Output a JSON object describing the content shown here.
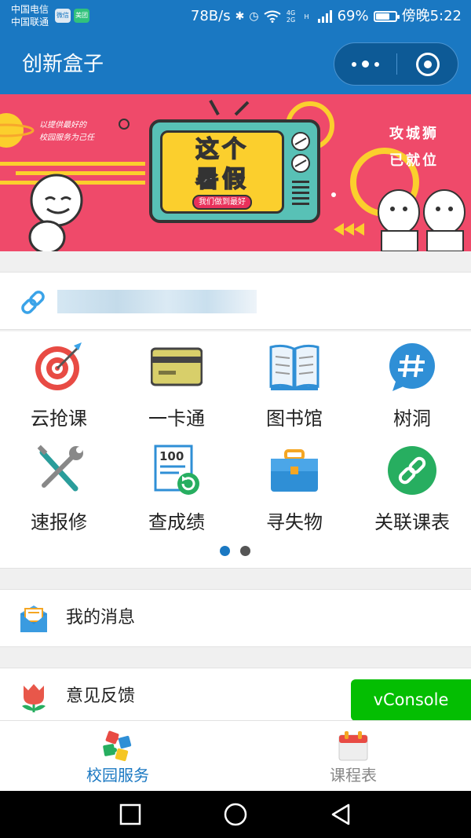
{
  "status_bar": {
    "carrier_1": "中国电信",
    "carrier_2": "中国联通",
    "wechat_app": "微信",
    "meituan_app": "美团",
    "net_speed": "78B/s",
    "bluetooth_icon": "bluetooth-icon",
    "alarm_icon": "alarm-icon",
    "wifi_icon": "wifi-icon",
    "net_4g_top": "4G",
    "net_4g_bottom": "2G",
    "hd_label": "H",
    "signal_icon": "signal-icon",
    "battery_percent": "69%",
    "battery_level": 0.69,
    "time": "傍晚5:22"
  },
  "nav": {
    "title": "创新盒子",
    "more_icon": "more-dots-icon",
    "close_icon": "target-close-icon"
  },
  "banner": {
    "tagline_1": "以提供最好的",
    "tagline_2": "校园服务为己任",
    "tv_title_1": "这个",
    "tv_title_2": "暑假",
    "tv_subtitle": "我们做到最好",
    "right_text_1": "攻城狮",
    "right_text_2": "已就位"
  },
  "account": {
    "link_icon": "link-icon"
  },
  "grid": {
    "items": [
      {
        "label": "云抢课",
        "icon": "target-icon"
      },
      {
        "label": "一卡通",
        "icon": "card-icon"
      },
      {
        "label": "图书馆",
        "icon": "book-icon"
      },
      {
        "label": "树洞",
        "icon": "hashtag-icon"
      },
      {
        "label": "速报修",
        "icon": "tools-icon"
      },
      {
        "label": "查成绩",
        "icon": "score-icon"
      },
      {
        "label": "寻失物",
        "icon": "briefcase-icon"
      },
      {
        "label": "关联课表",
        "icon": "chain-icon"
      }
    ],
    "score_number": "100",
    "pages": 2,
    "current_page": 1
  },
  "list": {
    "messages_label": "我的消息",
    "feedback_label": "意见反馈"
  },
  "vconsole_label": "vConsole",
  "tabbar": {
    "tab_campus_label": "校园服务",
    "tab_schedule_label": "课程表"
  },
  "colors": {
    "primary": "#1a78c2",
    "banner": "#ef4a6a",
    "vconsole": "#04be02"
  }
}
